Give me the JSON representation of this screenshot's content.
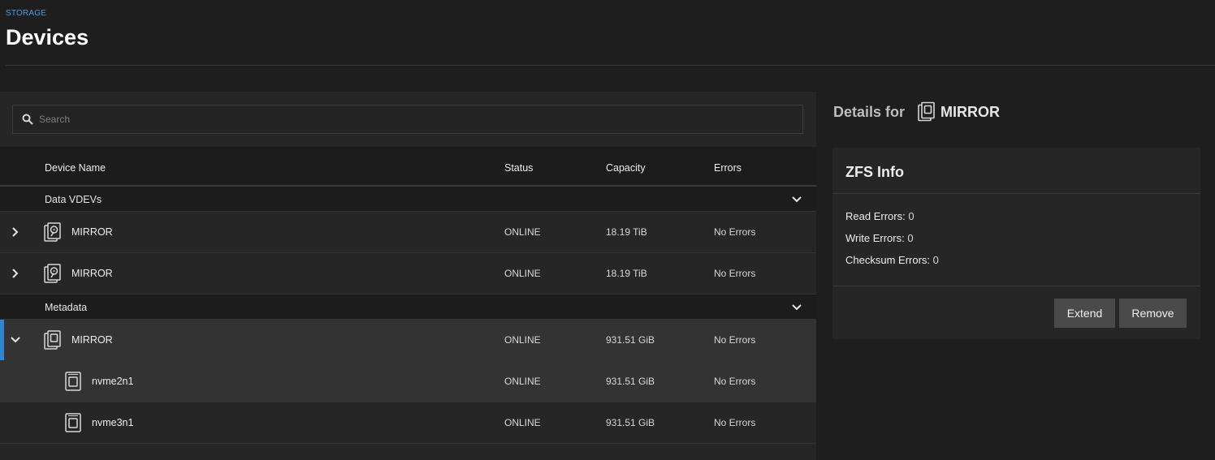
{
  "breadcrumb": "STORAGE",
  "page_title": "Devices",
  "search": {
    "placeholder": "Search",
    "value": ""
  },
  "table": {
    "headers": [
      "Device Name",
      "Status",
      "Capacity",
      "Errors"
    ],
    "groups": [
      {
        "label": "Data VDEVs",
        "rows": [
          {
            "name": "MIRROR",
            "status": "ONLINE",
            "capacity": "18.19 TiB",
            "errors": "No Errors"
          },
          {
            "name": "MIRROR",
            "status": "ONLINE",
            "capacity": "18.19 TiB",
            "errors": "No Errors"
          }
        ]
      },
      {
        "label": "Metadata",
        "rows": [
          {
            "name": "MIRROR",
            "status": "ONLINE",
            "capacity": "931.51 GiB",
            "errors": "No Errors"
          },
          {
            "name": "nvme2n1",
            "status": "ONLINE",
            "capacity": "931.51 GiB",
            "errors": "No Errors"
          },
          {
            "name": "nvme3n1",
            "status": "ONLINE",
            "capacity": "931.51 GiB",
            "errors": "No Errors"
          }
        ]
      }
    ]
  },
  "details": {
    "title_prefix": "Details for",
    "device_name": "MIRROR",
    "card": {
      "title": "ZFS Info",
      "read_errors_label": "Read Errors:",
      "read_errors_value": "0",
      "write_errors_label": "Write Errors:",
      "write_errors_value": "0",
      "checksum_errors_label": "Checksum Errors:",
      "checksum_errors_value": "0",
      "extend_label": "Extend",
      "remove_label": "Remove"
    }
  },
  "colors": {
    "accent": "#2f86d6",
    "breadcrumb": "#4d9de0",
    "background": "#1e1e1e",
    "panel": "#262626"
  }
}
